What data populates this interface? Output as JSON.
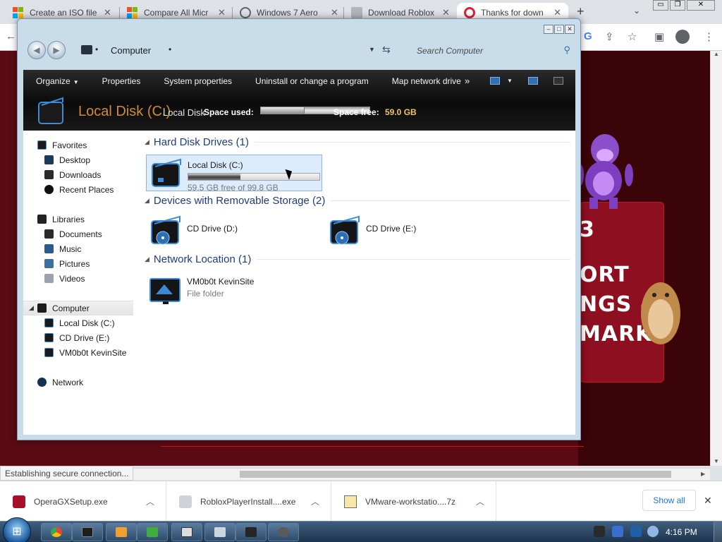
{
  "browser": {
    "tabs": [
      {
        "title": "Create an ISO file",
        "icon": "microsoft-logo"
      },
      {
        "title": "Compare All Micr",
        "icon": "microsoft-logo"
      },
      {
        "title": "Windows 7 Aero",
        "icon": "globe-icon"
      },
      {
        "title": "Download Roblox",
        "icon": "image-icon"
      },
      {
        "title": "Thanks for down",
        "icon": "opera-icon"
      }
    ],
    "status_text": "Establishing secure connection...",
    "downloads": [
      {
        "name": "OperaGXSetup.exe",
        "icon": "opera-gx-icon"
      },
      {
        "name": "RobloxPlayerInstall....exe",
        "icon": "roblox-icon"
      },
      {
        "name": "VMware-workstatio....7z",
        "icon": "archive-icon"
      }
    ],
    "show_all_label": "Show all"
  },
  "page_banner": {
    "lines": [
      "3",
      "ORT",
      "NGS &",
      "MARK"
    ]
  },
  "explorer": {
    "address": "Computer",
    "search_placeholder": "Search Computer",
    "commands": [
      "Organize",
      "Properties",
      "System properties",
      "Uninstall or change a program",
      "Map network drive"
    ],
    "details": {
      "title": "Local Disk (C:)",
      "subtitle": "Local Disk",
      "space_used_label": "Space used:",
      "space_used_fraction": 0.4,
      "space_free_label": "Space free:",
      "space_free_value": "59.0 GB"
    },
    "nav": [
      {
        "label": "Favorites",
        "icon": "star-icon",
        "level": 0
      },
      {
        "label": "Desktop",
        "icon": "desktop-icon",
        "level": 1
      },
      {
        "label": "Downloads",
        "icon": "downloads-icon",
        "level": 1
      },
      {
        "label": "Recent Places",
        "icon": "recent-icon",
        "level": 1
      },
      {
        "label": "Libraries",
        "icon": "libraries-icon",
        "level": 0
      },
      {
        "label": "Documents",
        "icon": "documents-icon",
        "level": 1
      },
      {
        "label": "Music",
        "icon": "music-icon",
        "level": 1
      },
      {
        "label": "Pictures",
        "icon": "pictures-icon",
        "level": 1
      },
      {
        "label": "Videos",
        "icon": "videos-icon",
        "level": 1
      },
      {
        "label": "Computer",
        "icon": "computer-icon",
        "level": 0,
        "selected": true
      },
      {
        "label": "Local Disk (C:)",
        "icon": "drive-icon",
        "level": 1
      },
      {
        "label": "CD Drive (E:)",
        "icon": "cd-drive-icon",
        "level": 1
      },
      {
        "label": "VM0b0t KevinSite",
        "icon": "network-folder-icon",
        "level": 1
      },
      {
        "label": "Network",
        "icon": "network-icon",
        "level": 0
      }
    ],
    "groups": [
      {
        "title": "Hard Disk Drives (1)"
      },
      {
        "title": "Devices with Removable Storage (2)"
      },
      {
        "title": "Network Location (1)"
      }
    ],
    "drives": {
      "local_c": {
        "name": "Local Disk (C:)",
        "free_text": "59.5 GB free of 99.8 GB",
        "used_fraction": 0.4
      },
      "cd_d": {
        "name": "CD Drive (D:)"
      },
      "cd_e": {
        "name": "CD Drive (E:)"
      },
      "netloc": {
        "name": "VM0b0t KevinSite",
        "type": "File folder"
      }
    }
  },
  "taskbar": {
    "clock": "4:16 PM",
    "buttons": [
      "chrome-icon",
      "explorer-window-icon",
      "media-player-icon",
      "green-app-icon",
      "7zip-icon",
      "folder-icon",
      "computer-app-icon",
      "roblox-app-icon"
    ]
  }
}
